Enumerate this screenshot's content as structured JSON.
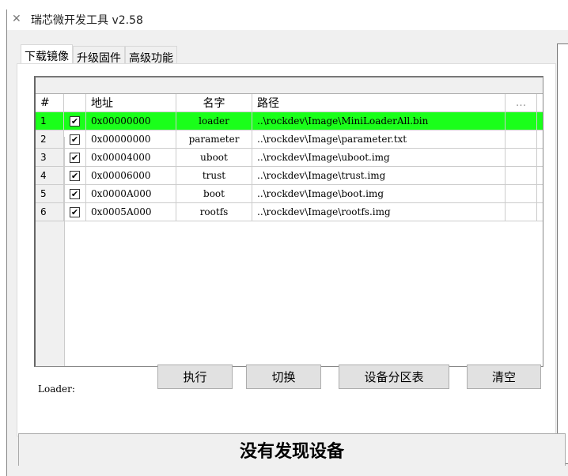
{
  "window": {
    "title": "瑞芯微开发工具 v2.58"
  },
  "tabs": [
    "下载镜像",
    "升级固件",
    "高级功能"
  ],
  "table": {
    "headers": [
      "#",
      "",
      "地址",
      "名字",
      "路径",
      "..."
    ],
    "rows": [
      {
        "num": "1",
        "checked": true,
        "addr": "0x00000000",
        "name": "loader",
        "path": "..\\rockdev\\Image\\MiniLoaderAll.bin"
      },
      {
        "num": "2",
        "checked": true,
        "addr": "0x00000000",
        "name": "parameter",
        "path": "..\\rockdev\\Image\\parameter.txt"
      },
      {
        "num": "3",
        "checked": true,
        "addr": "0x00004000",
        "name": "uboot",
        "path": "..\\rockdev\\Image\\uboot.img"
      },
      {
        "num": "4",
        "checked": true,
        "addr": "0x00006000",
        "name": "trust",
        "path": "..\\rockdev\\Image\\trust.img"
      },
      {
        "num": "5",
        "checked": true,
        "addr": "0x0000A000",
        "name": "boot",
        "path": "..\\rockdev\\Image\\boot.img"
      },
      {
        "num": "6",
        "checked": true,
        "addr": "0x0005A000",
        "name": "rootfs",
        "path": "..\\rockdev\\Image\\rootfs.img"
      }
    ]
  },
  "loader_label": "Loader:",
  "buttons": {
    "run": "执行",
    "switch": "切换",
    "partition": "设备分区表",
    "clear": "清空"
  },
  "status": "没有发现设备",
  "colors": {
    "selected_row": "#1aff1a"
  }
}
